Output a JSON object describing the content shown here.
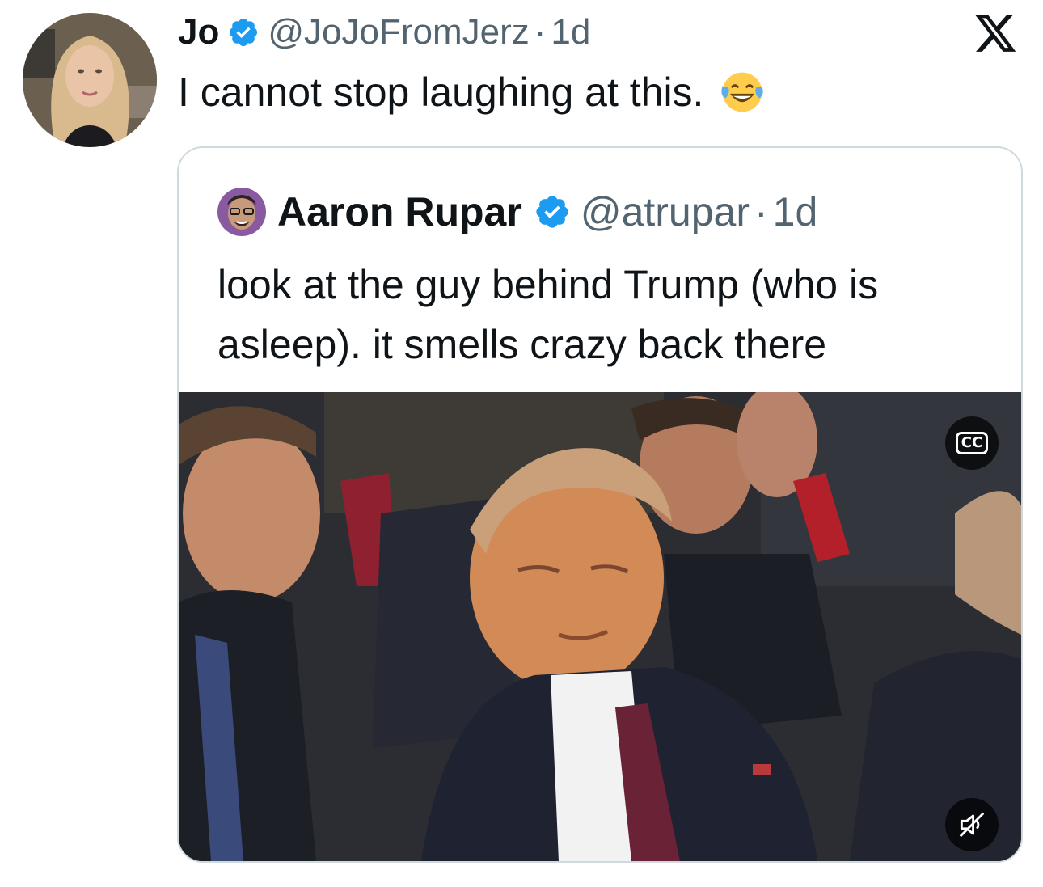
{
  "tweet": {
    "author_name": "Jo",
    "handle": "@JoJoFromJerz",
    "separator": "·",
    "time": "1d",
    "text": "I cannot stop laughing at this.",
    "emoji": "face-with-tears-of-joy",
    "verified": true
  },
  "quoted_tweet": {
    "author_name": "Aaron Rupar",
    "handle": "@atrupar",
    "separator": "·",
    "time": "1d",
    "text": "look at the guy behind Trump (who is asleep). it smells crazy back there",
    "verified": true
  },
  "media": {
    "type": "video",
    "captions_button": "CC",
    "muted": true
  },
  "icons": {
    "brand": "x-logo-icon",
    "verified": "verified-badge-icon",
    "captions": "captions-icon",
    "mute": "speaker-muted-icon"
  },
  "colors": {
    "text_primary": "#0f1419",
    "text_secondary": "#536471",
    "verified_blue": "#1d9bf0",
    "border": "#cfd9de"
  }
}
